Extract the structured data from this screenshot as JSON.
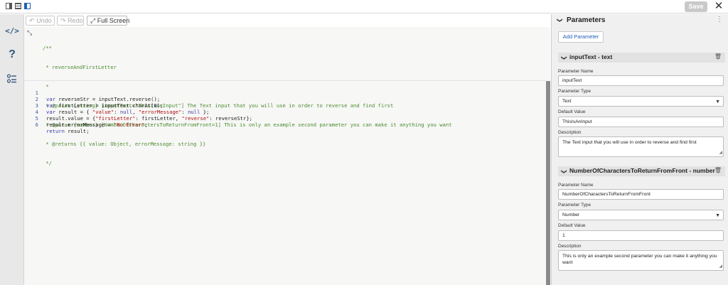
{
  "topbar": {
    "layout_icons": [
      "layout-left-icon",
      "layout-list-icon",
      "layout-right-icon"
    ],
    "save_label": "Save",
    "close_glyph": "✕"
  },
  "leftnav": {
    "items": [
      {
        "name": "code-icon",
        "glyph": "</>"
      },
      {
        "name": "help-icon",
        "glyph": "?"
      },
      {
        "name": "list-icon",
        "glyph": "☰"
      }
    ]
  },
  "toolbar": {
    "undo_label": "Undo",
    "redo_label": "Redo",
    "fullscreen_label": "Full Screen"
  },
  "editor": {
    "comment_lines": [
      "/**",
      " * reverseAndFirstLetter",
      " *",
      " * @param {string} [inputText=\"ThisIsAnInput\"] The Text input that you will use in order to reverse and find first",
      " * @param {number} [NumberOfCharactersToReturnFromFront=1] This is only an example second parameter you can make it anything you want",
      " * @returns {{ value: Object, errorMessage: string }}",
      " */"
    ],
    "line_numbers": [
      "1",
      "2",
      "3",
      "4",
      "5",
      "6"
    ]
  },
  "parameters": {
    "title": "Parameters",
    "add_label": "Add Parameter",
    "items": [
      {
        "header": "inputText - text",
        "name_label": "Parameter Name",
        "name_value": "inputText",
        "type_label": "Parameter Type",
        "type_value": "Text",
        "default_label": "Default Value",
        "default_value": "ThisIsAnInput",
        "desc_label": "Description",
        "desc_value": "The Text input that you will use in order to reverse and find first"
      },
      {
        "header": "NumberOfCharactersToReturnFromFront - number",
        "name_label": "Parameter Name",
        "name_value": "NumberOfCharactersToReturnFromFront",
        "type_label": "Parameter Type",
        "type_value": "Number",
        "default_label": "Default Value",
        "default_value": "1",
        "desc_label": "Description",
        "desc_value": "This is only an example second parameter you can make it anything you want"
      }
    ]
  },
  "colors": {
    "accent": "#1f5fb5",
    "nav_icon": "#31577d",
    "comment": "#4c8c2e",
    "keyword": "#3a3aa8",
    "string": "#a11"
  }
}
